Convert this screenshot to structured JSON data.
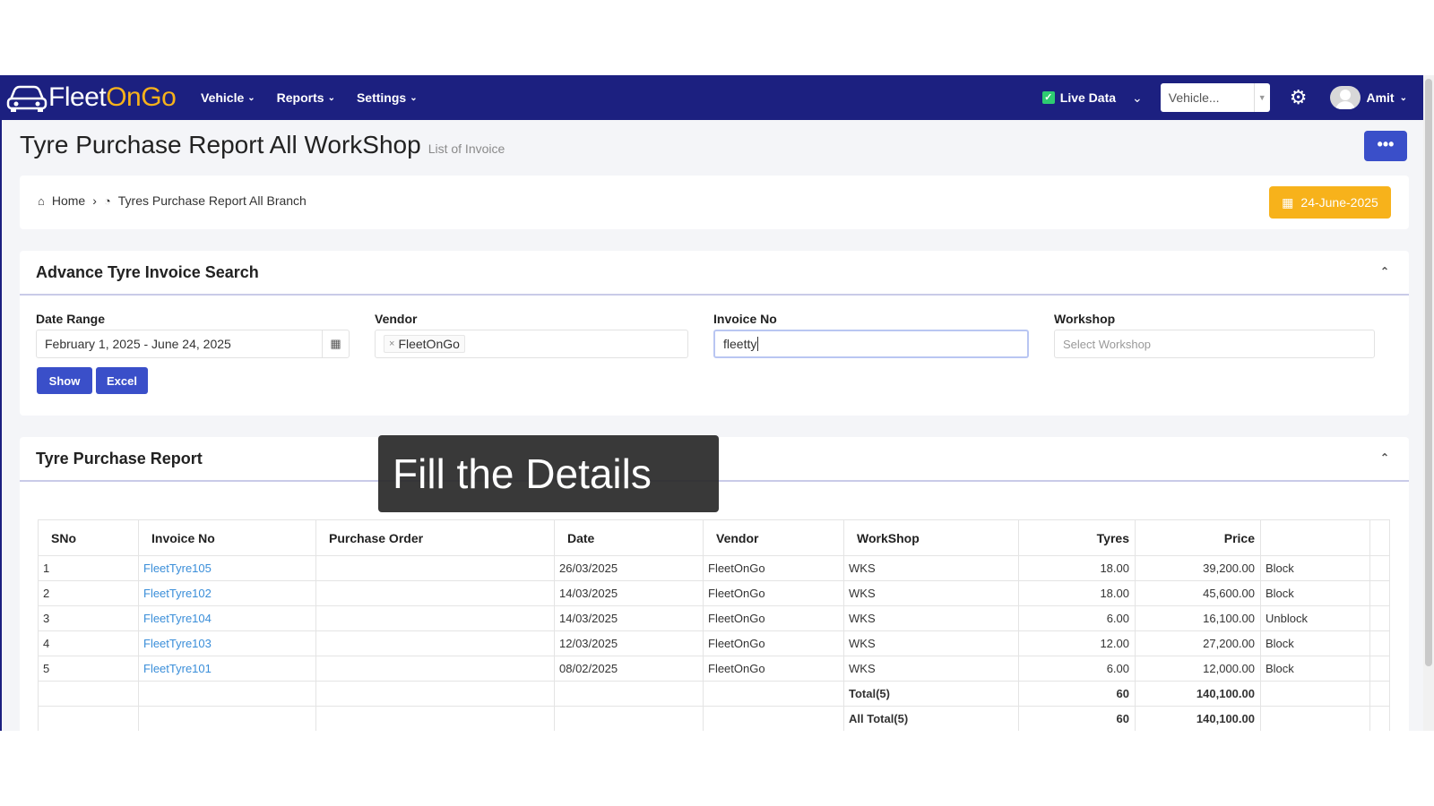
{
  "app": {
    "logo": {
      "part1": "Fleet",
      "part2": "On",
      "part3": "Go"
    }
  },
  "nav": {
    "menu": [
      "Vehicle",
      "Reports",
      "Settings"
    ],
    "live_data_label": "Live Data",
    "vehicle_select": "Vehicle...",
    "user_name": "Amit"
  },
  "page": {
    "title": "Tyre Purchase Report All WorkShop",
    "subtitle": "List of Invoice",
    "more_label": "•••"
  },
  "breadcrumb": {
    "home": "Home",
    "current": "Tyres Purchase Report All Branch",
    "date": "24-June-2025"
  },
  "search": {
    "title": "Advance Tyre Invoice Search",
    "date_range_label": "Date Range",
    "date_range_value": "February 1, 2025 - June 24, 2025",
    "vendor_label": "Vendor",
    "vendor_tag": "FleetOnGo",
    "invoice_label": "Invoice No",
    "invoice_value": "fleetty",
    "workshop_label": "Workshop",
    "workshop_placeholder": "Select Workshop",
    "show_label": "Show",
    "excel_label": "Excel"
  },
  "report": {
    "title": "Tyre Purchase Report",
    "columns": [
      "SNo",
      "Invoice No",
      "Purchase Order",
      "Date",
      "Vendor",
      "WorkShop",
      "Tyres",
      "Price"
    ],
    "rows": [
      {
        "sno": "1",
        "invoice": "FleetTyre105",
        "po": "",
        "date": "26/03/2025",
        "vendor": "FleetOnGo",
        "workshop": "WKS",
        "tyres": "18.00",
        "price": "39,200.00",
        "status": "Block"
      },
      {
        "sno": "2",
        "invoice": "FleetTyre102",
        "po": "",
        "date": "14/03/2025",
        "vendor": "FleetOnGo",
        "workshop": "WKS",
        "tyres": "18.00",
        "price": "45,600.00",
        "status": "Block"
      },
      {
        "sno": "3",
        "invoice": "FleetTyre104",
        "po": "",
        "date": "14/03/2025",
        "vendor": "FleetOnGo",
        "workshop": "WKS",
        "tyres": "6.00",
        "price": "16,100.00",
        "status": "Unblock"
      },
      {
        "sno": "4",
        "invoice": "FleetTyre103",
        "po": "",
        "date": "12/03/2025",
        "vendor": "FleetOnGo",
        "workshop": "WKS",
        "tyres": "12.00",
        "price": "27,200.00",
        "status": "Block"
      },
      {
        "sno": "5",
        "invoice": "FleetTyre101",
        "po": "",
        "date": "08/02/2025",
        "vendor": "FleetOnGo",
        "workshop": "WKS",
        "tyres": "6.00",
        "price": "12,000.00",
        "status": "Block"
      }
    ],
    "total": {
      "label": "Total(5)",
      "tyres": "60",
      "price": "140,100.00"
    },
    "all_total": {
      "label": "All Total(5)",
      "tyres": "60",
      "price": "140,100.00"
    }
  },
  "overlay": {
    "text": "Fill the Details"
  }
}
